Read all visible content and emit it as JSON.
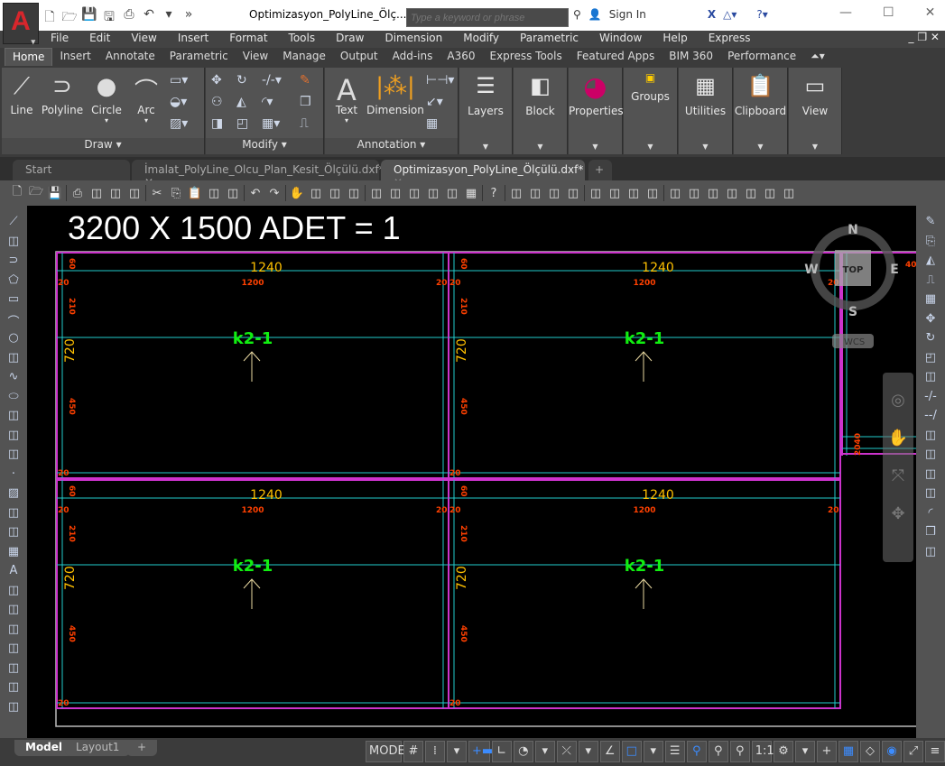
{
  "app": {
    "logo_letter": "A",
    "window_title": "Optimizasyon_PolyLine_Ölç...",
    "search_placeholder": "Type a keyword or phrase",
    "sign_in": "Sign In",
    "accent": "#d7262c"
  },
  "qat_icons": [
    "new-icon",
    "open-icon",
    "save-icon",
    "save-as-icon",
    "print-icon",
    "undo-icon",
    "dropdown-icon",
    "more-icon"
  ],
  "window_controls": {
    "minimize": "—",
    "maximize": "☐",
    "close": "✕"
  },
  "menu": [
    "File",
    "Edit",
    "View",
    "Insert",
    "Format",
    "Tools",
    "Draw",
    "Dimension",
    "Modify",
    "Parametric",
    "Window",
    "Help",
    "Express"
  ],
  "ribbon_tabs": [
    "Home",
    "Insert",
    "Annotate",
    "Parametric",
    "View",
    "Manage",
    "Output",
    "Add-ins",
    "A360",
    "Express Tools",
    "Featured Apps",
    "BIM 360",
    "Performance"
  ],
  "ribbon": {
    "draw": {
      "title": "Draw",
      "line": "Line",
      "polyline": "Polyline",
      "circle": "Circle",
      "arc": "Arc"
    },
    "modify": {
      "title": "Modify"
    },
    "annotation": {
      "title": "Annotation",
      "text": "Text",
      "dimension": "Dimension"
    },
    "layers": "Layers",
    "block": "Block",
    "properties": "Properties",
    "groups": "Groups",
    "utilities": "Utilities",
    "clipboard": "Clipboard",
    "view": "View"
  },
  "file_tabs": [
    {
      "label": "Start"
    },
    {
      "label": "İmalat_PolyLine_Olcu_Plan_Kesit_Ölçülü.dxf*"
    },
    {
      "label": "Optimizasyon_PolyLine_Ölçülü.dxf*",
      "active": true
    }
  ],
  "toolbar_icons": [
    "new",
    "open",
    "save",
    "|",
    "print",
    "preview",
    "plot",
    "publish",
    "|",
    "cut",
    "copy",
    "paste",
    "match-properties",
    "block-editor",
    "|",
    "undo",
    "redo",
    "|",
    "pan",
    "zoom-realtime",
    "zoom-window",
    "zoom-previous",
    "|",
    "properties",
    "design-center",
    "tool-palettes",
    "sheet-set",
    "markup",
    "calculator",
    "|",
    "help",
    "|",
    "dim-linear",
    "dim-aligned",
    "dim-arc",
    "dim-ordinate",
    "|",
    "dim-radius",
    "dim-jogged",
    "dim-diameter",
    "dim-angular",
    "|",
    "quick-dim",
    "baseline",
    "continue",
    "dim-space",
    "dim-break",
    "tolerance",
    "center-mark"
  ],
  "left_tools": [
    "line",
    "construction-line",
    "polyline",
    "polygon",
    "rectangle",
    "arc",
    "circle",
    "revcloud",
    "spline",
    "ellipse",
    "ellipse-arc",
    "insert-block",
    "make-block",
    "point",
    "hatch",
    "gradient",
    "region",
    "table",
    "multiline-text",
    "add-selected",
    "zoom-window",
    "zoom-dynamic",
    "zoom-scale",
    "zoom-center",
    "zoom-object",
    "zoom-in"
  ],
  "right_tools": [
    "erase",
    "copy",
    "mirror",
    "offset",
    "array",
    "move",
    "rotate",
    "scale",
    "stretch",
    "trim",
    "extend",
    "break-at-point",
    "break",
    "join",
    "chamfer",
    "fillet",
    "explode",
    "3d-orbit"
  ],
  "drawing": {
    "title": "3200 X 1500 ADET = 1",
    "panel_label": "k2-1",
    "dim_outer": "1240",
    "dim_inner": "1200",
    "dim_height": "720",
    "dim_top": "210",
    "dim_bottom": "450",
    "dim_edge": "60",
    "dim_gap": "20",
    "dim_right": "40",
    "dim_side": "2040",
    "colors": {
      "frame": "#cc33cc",
      "inner": "#22cccc",
      "dim_major": "#ffc000",
      "dim_minor": "#ff4000",
      "label": "#11ee11",
      "arrow": "#e8d8a0"
    }
  },
  "viewcube": {
    "n": "N",
    "s": "S",
    "e": "E",
    "w": "W",
    "face": "TOP",
    "ucs": "WCS"
  },
  "layout_tabs": [
    "Model",
    "Layout1",
    "+"
  ],
  "status": {
    "model": "MODEL",
    "scale": "1:1",
    "items": [
      "grid",
      "snap",
      "dropdown",
      "dynamic-input",
      "ortho",
      "polar",
      "dropdown",
      "osnap",
      "dropdown",
      "otrack",
      "lineweight-square",
      "dropdown",
      "transparency",
      "annotation-visibility",
      "autoscale",
      "annotation-scale",
      "1:1",
      "workspace-gear",
      "dropdown",
      "plus",
      "quick-properties",
      "isolate",
      "hardware-acceleration",
      "fullscreen",
      "customize"
    ]
  }
}
